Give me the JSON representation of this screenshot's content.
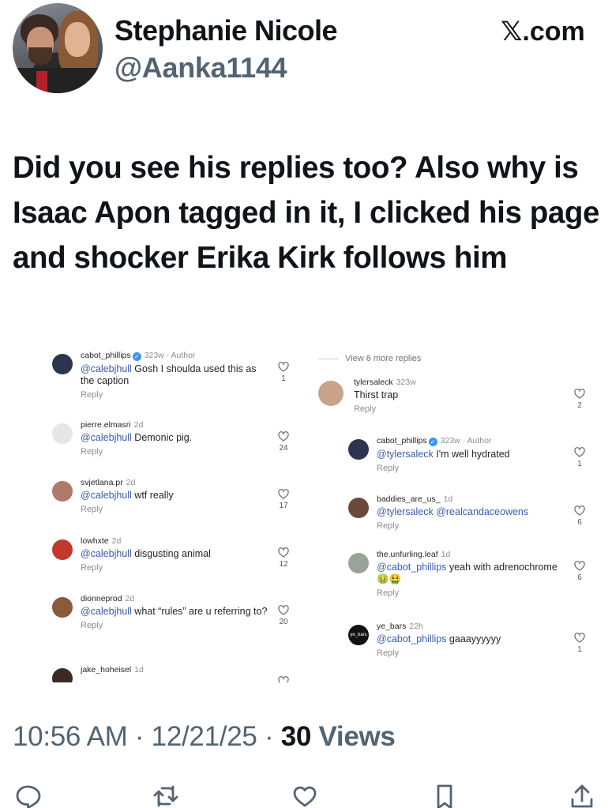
{
  "author": {
    "display_name": "Stephanie Nicole",
    "handle": "@Aanka1144"
  },
  "site": {
    "x_glyph": "𝕏",
    "suffix": ".com"
  },
  "post_text": "Did you see his replies too? Also why is Isaac Apon tagged in it, I clicked his page and shocker Erika Kirk follows him",
  "embedded_screenshot": {
    "left_column": [
      {
        "username": "cabot_phillips",
        "verified": true,
        "meta": "323w · Author",
        "mention": "@calebjhull",
        "text": " Gosh I shoulda used this as the caption",
        "reply": "Reply",
        "likes": "1",
        "avatar_color": "#2b3550"
      },
      {
        "username": "pierre.elmasri",
        "verified": false,
        "meta": "2d",
        "mention": "@calebjhull",
        "text": " Demonic pig.",
        "reply": "Reply",
        "likes": "24",
        "avatar_color": "#e6e6e6"
      },
      {
        "username": "svjetlana.pr",
        "verified": false,
        "meta": "2d",
        "mention": "@calebjhull",
        "text": " wtf really",
        "reply": "Reply",
        "likes": "17",
        "avatar_color": "#b07a6a"
      },
      {
        "username": "lowhxte",
        "verified": false,
        "meta": "2d",
        "mention": "@calebjhull",
        "text": " disgusting animal",
        "reply": "Reply",
        "likes": "12",
        "avatar_color": "#c0392b"
      },
      {
        "username": "dionneprod",
        "verified": false,
        "meta": "2d",
        "mention": "@calebjhull",
        "text": " what “rules” are u referring to?",
        "reply": "Reply",
        "likes": "20",
        "avatar_color": "#8a5a3a"
      },
      {
        "username": "jake_hoheisel",
        "verified": false,
        "meta": "1d",
        "mention": "",
        "text": "",
        "reply": "",
        "likes": "",
        "avatar_color": "#3a2a22"
      }
    ],
    "right_column": {
      "view_more": "View 6 more replies",
      "comments": [
        {
          "username": "tylersaleck",
          "verified": false,
          "meta": "323w",
          "mention": "",
          "text": "Thirst trap",
          "reply": "Reply",
          "likes": "2",
          "avatar_color": "#c9a48a"
        },
        {
          "username": "cabot_phillips",
          "verified": true,
          "meta": "323w · Author",
          "mention": "@tylersaleck",
          "text": " I'm well hydrated",
          "reply": "Reply",
          "likes": "1",
          "avatar_color": "#2b3550"
        },
        {
          "username": "baddies_are_us_",
          "verified": false,
          "meta": "1d",
          "mention": "@tylersaleck @realcandaceowens",
          "text": "",
          "reply": "Reply",
          "likes": "6",
          "avatar_color": "#6a4a3a"
        },
        {
          "username": "the.unfurling.leaf",
          "verified": false,
          "meta": "1d",
          "mention": "@cabot_phillips",
          "text": " yeah with adrenochrome 🤢🤮",
          "reply": "Reply",
          "likes": "6",
          "avatar_color": "#9aa39a"
        },
        {
          "username": "ye_bars",
          "verified": false,
          "meta": "22h",
          "mention": "@cabot_phillips",
          "text": " gaaayyyyyy",
          "reply": "Reply",
          "likes": "1",
          "avatar_color": "#111111",
          "avatar_text": "ye_bars"
        }
      ]
    }
  },
  "timestamp": {
    "time_date": "10:56 AM · 12/21/25 · ",
    "views_count": "30",
    "views_label": " Views"
  },
  "icons": [
    "reply-icon",
    "repost-icon",
    "like-icon",
    "bookmark-icon",
    "share-icon"
  ],
  "colors": {
    "secondary_text": "#536471",
    "mention": "#3b5ba8",
    "verified": "#3897f0"
  }
}
